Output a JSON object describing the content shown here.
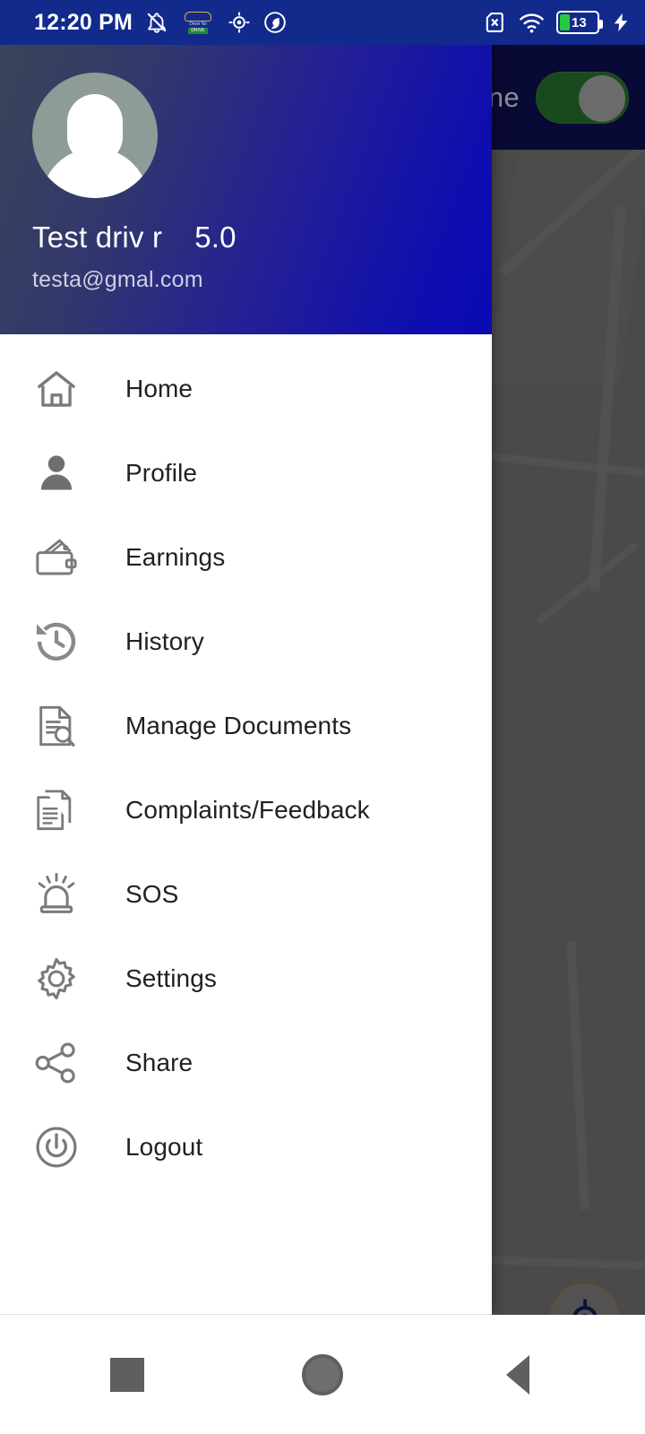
{
  "status_bar": {
    "time": "12:20 PM",
    "battery_level": "13",
    "icons": [
      "notifications-off-icon",
      "car-app-badge-icon",
      "gps-fixed-icon",
      "assist-circle-icon",
      "sim-missing-icon",
      "wifi-icon",
      "battery-icon",
      "charging-bolt-icon"
    ],
    "colors": {
      "background": "#122a8c",
      "battery_fill": "#27c93f"
    }
  },
  "app_bar": {
    "status_label": "ine",
    "toggle_state": "on",
    "colors": {
      "background": "#0d0d4d",
      "toggle_on": "#246b2b",
      "toggle_knob": "#9a9a9a"
    }
  },
  "map": {
    "fab_label": "my-location",
    "colors": {
      "surface": "#6b6b6b",
      "fab_border": "#a6731f",
      "fab_icon": "#0d1a4d"
    }
  },
  "drawer": {
    "header": {
      "user_name": "Test driv r",
      "rating": "5.0",
      "email": "testa@gmal.com",
      "avatar": "default-user-avatar",
      "colors": {
        "gradient_start": "#3b4459",
        "gradient_end": "#0a0ab5"
      }
    },
    "menu": [
      {
        "label": "Home",
        "icon": "home-icon"
      },
      {
        "label": "Profile",
        "icon": "person-icon"
      },
      {
        "label": "Earnings",
        "icon": "wallet-icon"
      },
      {
        "label": "History",
        "icon": "history-clock-icon"
      },
      {
        "label": "Manage Documents",
        "icon": "document-search-icon"
      },
      {
        "label": "Complaints/Feedback",
        "icon": "documents-stack-icon"
      },
      {
        "label": "SOS",
        "icon": "emergency-siren-icon"
      },
      {
        "label": "Settings",
        "icon": "gear-icon"
      },
      {
        "label": "Share",
        "icon": "share-nodes-icon"
      },
      {
        "label": "Logout",
        "icon": "power-off-icon"
      }
    ]
  },
  "nav_bar": {
    "recents": "recents-square-icon",
    "home": "home-circle-icon",
    "back": "back-triangle-icon"
  }
}
